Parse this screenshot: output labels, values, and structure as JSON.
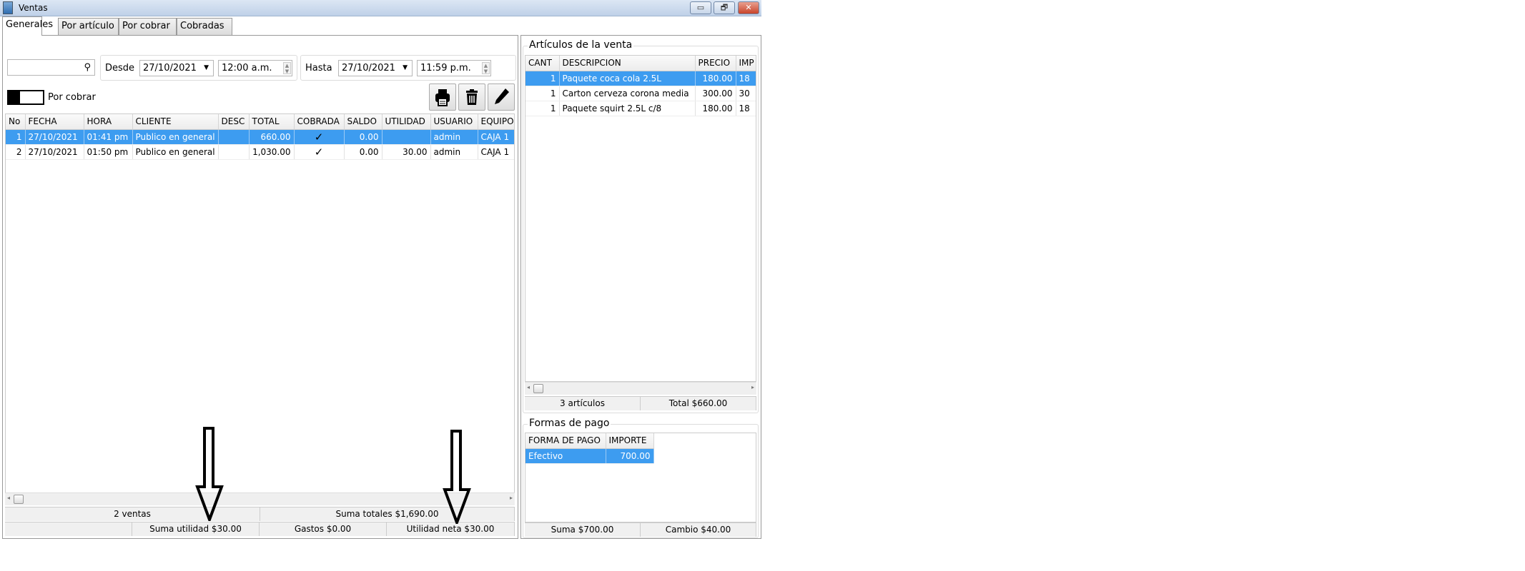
{
  "window": {
    "title": "Ventas",
    "minimize": "▭",
    "restore": "🗗",
    "close": "✕"
  },
  "tabs": [
    {
      "label": "Generales",
      "active": true
    },
    {
      "label": "Por artículo"
    },
    {
      "label": "Por cobrar"
    },
    {
      "label": "Cobradas"
    }
  ],
  "filters": {
    "search_value": "",
    "search_icon": "search-icon",
    "desde_label": "Desde",
    "desde_date": "27/10/2021",
    "desde_time": "12:00 a.m.",
    "hasta_label": "Hasta",
    "hasta_date": "27/10/2021",
    "hasta_time": "11:59 p.m.",
    "por_cobrar_label": "Por cobrar",
    "por_cobrar_on": false
  },
  "sales_table": {
    "columns": [
      "No",
      "FECHA",
      "HORA",
      "CLIENTE",
      "DESC",
      "TOTAL",
      "COBRADA",
      "SALDO",
      "UTILIDAD",
      "USUARIO",
      "EQUIPO"
    ],
    "rows": [
      {
        "no": "1",
        "fecha": "27/10/2021",
        "hora": "01:41 pm",
        "cliente": "Publico en general",
        "desc": "",
        "total": "660.00",
        "cobrada": "✓",
        "saldo": "0.00",
        "utilidad": "",
        "usuario": "admin",
        "equipo": "CAJA 1",
        "selected": true
      },
      {
        "no": "2",
        "fecha": "27/10/2021",
        "hora": "01:50 pm",
        "cliente": "Publico en general",
        "desc": "",
        "total": "1,030.00",
        "cobrada": "✓",
        "saldo": "0.00",
        "utilidad": "30.00",
        "usuario": "admin",
        "equipo": "CAJA 1",
        "selected": false
      }
    ]
  },
  "left_status": {
    "ventas": "2 ventas",
    "suma_totales": "Suma totales $1,690.00",
    "suma_utilidad": "Suma utilidad $30.00",
    "gastos": "Gastos $0.00",
    "utilidad_neta": "Utilidad neta $30.00"
  },
  "articulos": {
    "title": "Artículos de la venta",
    "columns": [
      "CANT",
      "DESCRIPCION",
      "PRECIO",
      "IMP"
    ],
    "rows": [
      {
        "cant": "1",
        "descripcion": "Paquete coca cola 2.5L",
        "precio": "180.00",
        "importe": "18",
        "selected": true
      },
      {
        "cant": "1",
        "descripcion": "Carton cerveza corona media",
        "precio": "300.00",
        "importe": "30",
        "selected": false
      },
      {
        "cant": "1",
        "descripcion": "Paquete squirt 2.5L c/8",
        "precio": "180.00",
        "importe": "18",
        "selected": false
      }
    ],
    "count": "3 artículos",
    "total": "Total $660.00"
  },
  "formas_pago": {
    "title": "Formas de pago",
    "columns": [
      "FORMA DE PAGO",
      "IMPORTE"
    ],
    "rows": [
      {
        "forma": "Efectivo",
        "importe": "700.00",
        "selected": true
      }
    ],
    "suma": "Suma $700.00",
    "cambio": "Cambio $40.00"
  },
  "colors": {
    "selection": "#3d9cf0",
    "titlebar": "#c9d9ec"
  }
}
